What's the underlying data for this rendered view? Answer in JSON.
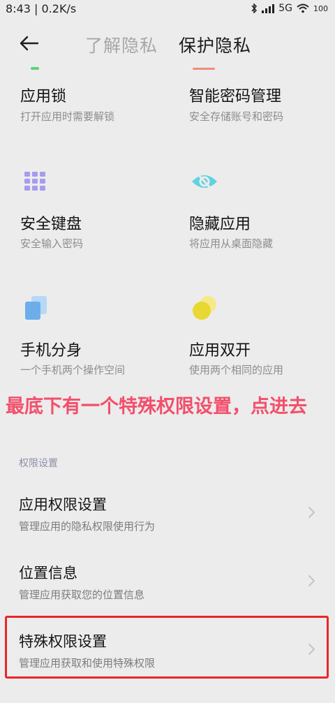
{
  "status_bar": {
    "left": "8:43 | 0.2K/s",
    "network": "5G",
    "battery": "100",
    "icons": [
      "bluetooth-icon",
      "signal-icon",
      "wifi-icon",
      "battery-icon"
    ]
  },
  "header": {
    "back_icon": "arrow-left-icon",
    "tabs": [
      {
        "label": "了解隐私",
        "active": false
      },
      {
        "label": "保护隐私",
        "active": true
      }
    ]
  },
  "features": [
    {
      "title": "应用锁",
      "desc": "打开应用时需要解锁"
    },
    {
      "title": "智能密码管理",
      "desc": "安全存储账号和密码"
    },
    {
      "title": "安全键盘",
      "desc": "安全输入密码",
      "icon": "keyboard-grid-icon",
      "color": "#a59cf0"
    },
    {
      "title": "隐藏应用",
      "desc": "将应用从桌面隐藏",
      "icon": "eye-off-icon",
      "color": "#5fd3e0"
    },
    {
      "title": "手机分身",
      "desc": "一个手机两个操作空间",
      "icon": "dual-cards-icon",
      "color": "#8fc1f2"
    },
    {
      "title": "应用双开",
      "desc": "使用两个相同的应用",
      "icon": "dual-circles-icon",
      "color": "#ecdc3a"
    }
  ],
  "annotation": "最底下有一个特殊权限设置，点进去",
  "annotation_color": "#f24f6b",
  "permissions": {
    "section_label": "权限设置",
    "items": [
      {
        "title": "应用权限设置",
        "subtitle": "管理应用的隐私权限使用行为"
      },
      {
        "title": "位置信息",
        "subtitle": "管理应用获取您的位置信息"
      },
      {
        "title": "特殊权限设置",
        "subtitle": "管理应用获取和使用特殊权限",
        "highlighted": true
      }
    ],
    "highlight_color": "#e8262a"
  }
}
